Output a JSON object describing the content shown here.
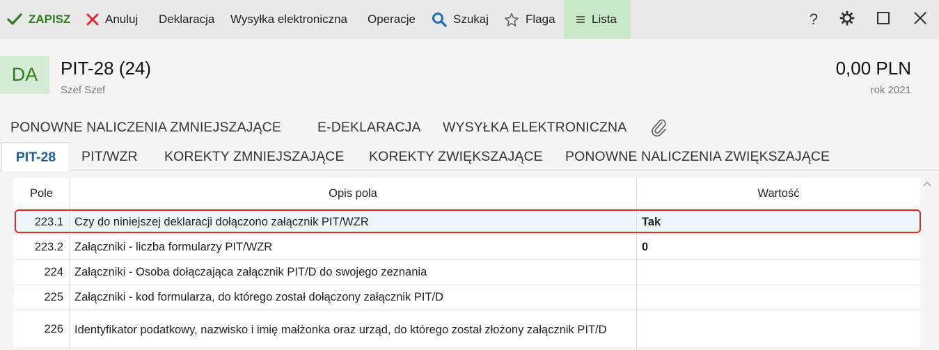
{
  "toolbar": {
    "save": "ZAPISZ",
    "cancel": "Anuluj",
    "declaration": "Deklaracja",
    "electronic_send": "Wysyłka elektroniczna",
    "operations": "Operacje",
    "search": "Szukaj",
    "flag": "Flaga",
    "list": "Lista",
    "help": "?"
  },
  "document": {
    "badge": "DA",
    "title": "PIT-28 (24)",
    "subtitle": "Szef Szef",
    "amount": "0,00 PLN",
    "year": "rok 2021"
  },
  "tabs_top": [
    "PONOWNE NALICZENIA ZMNIEJSZAJĄCE",
    "E-DEKLARACJA",
    "WYSYŁKA ELEKTRONICZNA"
  ],
  "tabs_bottom": {
    "active": "PIT-28",
    "items": [
      "PIT/WZR",
      "KOREKTY ZMNIEJSZAJĄCE",
      "KOREKTY ZWIĘKSZAJĄCE",
      "PONOWNE NALICZENIA ZWIĘKSZAJĄCE"
    ]
  },
  "table": {
    "headers": {
      "pole": "Pole",
      "opis": "Opis pola",
      "wartosc": "Wartość"
    },
    "rows": [
      {
        "pole": "223.1",
        "opis": "Czy do niniejszej deklaracji dołączono załącznik PIT/WZR",
        "wartosc": "Tak"
      },
      {
        "pole": "223.2",
        "opis": "Załączniki - liczba formularzy PIT/WZR",
        "wartosc": "0"
      },
      {
        "pole": "224",
        "opis": "Załączniki - Osoba dołączająca załącznik PIT/D do swojego zeznania",
        "wartosc": ""
      },
      {
        "pole": "225",
        "opis": "Załączniki - kod formularza, do którego został dołączony załącznik PIT/D",
        "wartosc": ""
      },
      {
        "pole": "226",
        "opis": "Identyfikator podatkowy, nazwisko i imię małżonka oraz urząd, do którego został złożony załącznik PIT/D",
        "wartosc": ""
      }
    ]
  },
  "colors": {
    "accent_green": "#2e7d1e",
    "active_tab_blue": "#1f5f99",
    "highlight_red": "#e02b2b"
  }
}
